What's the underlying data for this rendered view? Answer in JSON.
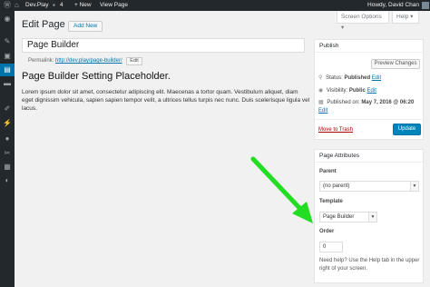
{
  "adminbar": {
    "site_name": "Dev.Play",
    "comments_count": "4",
    "new_label": "+ New",
    "view_page": "View Page",
    "howdy": "Howdy, David Chan"
  },
  "icons": {
    "wp_logo": "wordpress-icon",
    "home": "home-icon",
    "comments": "comment-icon",
    "dashboard": "dashboard-icon",
    "posts": "pin-icon",
    "media": "media-icon",
    "pages": "pages-icon",
    "menu_comments": "comment-icon",
    "appearance": "brush-icon",
    "plugins": "plugin-icon",
    "users": "user-icon",
    "tools": "wrench-icon",
    "settings": "settings-icon",
    "collapse": "collapse-icon"
  },
  "header": {
    "screen_options": "Screen Options ▾",
    "help": "Help ▾",
    "title": "Edit Page",
    "add_new": "Add New"
  },
  "editor": {
    "title_value": "Page Builder",
    "permalink_label": "Permalink:",
    "permalink_url": "http://dev.play/page-builder/",
    "edit_label": "Edit",
    "content_heading": "Page Builder Setting Placeholder.",
    "content_body": "Lorem ipsum dolor sit amet, consectetur adipiscing elit. Maecenas a tortor quam. Vestibulum aliquet, diam eget dignissim vehicula, sapien sapien tempor velit, a ultrices tellus turpis nec nunc. Duis scelerisque ligula vel lacus."
  },
  "publish": {
    "title": "Publish",
    "preview_changes": "Preview Changes",
    "status_label": "Status:",
    "status_value": "Published",
    "status_edit": "Edit",
    "visibility_label": "Visibility:",
    "visibility_value": "Public",
    "visibility_edit": "Edit",
    "published_label": "Published on:",
    "published_value": "May 7, 2016 @ 06:20",
    "published_edit": "Edit",
    "move_to_trash": "Move to Trash",
    "update": "Update"
  },
  "attributes": {
    "title": "Page Attributes",
    "parent_label": "Parent",
    "parent_value": "(no parent)",
    "template_label": "Template",
    "template_value": "Page Builder",
    "order_label": "Order",
    "order_value": "0",
    "help_text": "Need help? Use the Help tab in the upper right of your screen."
  },
  "colors": {
    "admin_bar": "#23282d",
    "accent": "#0073aa",
    "primary_button": "#0085ba",
    "annotation_arrow": "#22dd22"
  }
}
